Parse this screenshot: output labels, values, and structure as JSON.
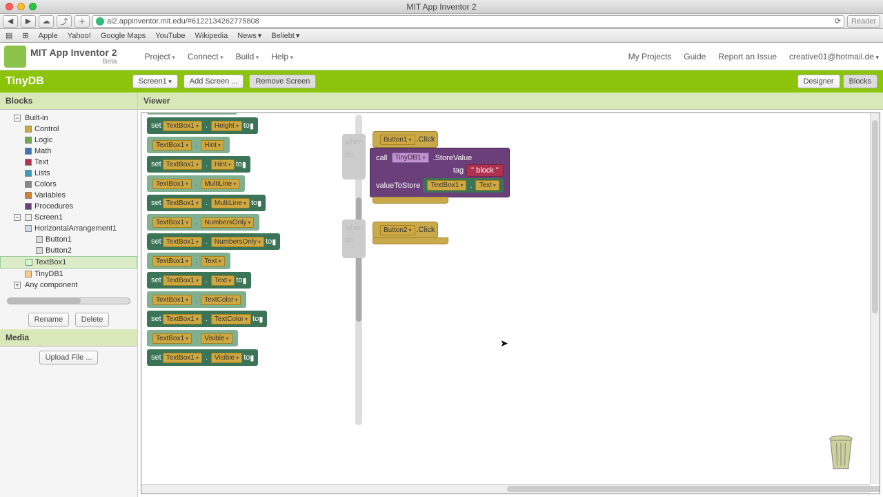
{
  "window": {
    "title": "MIT App Inventor 2"
  },
  "browser": {
    "url": "ai2.appinventor.mit.edu/#6122134262775808",
    "reader": "Reader",
    "bookmarks": [
      "Apple",
      "Yahoo!",
      "Google Maps",
      "YouTube",
      "Wikipedia",
      "News",
      "Beliebt"
    ]
  },
  "app": {
    "brand": "MIT App Inventor 2",
    "beta": "Beta",
    "menus": [
      "Project",
      "Connect",
      "Build",
      "Help"
    ],
    "links": {
      "myprojects": "My Projects",
      "guide": "Guide",
      "report": "Report an Issue",
      "account": "creative01@hotmail.de"
    }
  },
  "greenbar": {
    "project": "TinyDB",
    "screen": "Screen1",
    "addscreen": "Add Screen ...",
    "removescreen": "Remove Screen",
    "designer": "Designer",
    "blocks": "Blocks"
  },
  "sidebar": {
    "blocks_title": "Blocks",
    "builtin": "Built-in",
    "categories": [
      {
        "label": "Control",
        "color": "#d0a840"
      },
      {
        "label": "Logic",
        "color": "#6fa84f"
      },
      {
        "label": "Math",
        "color": "#3f71b5"
      },
      {
        "label": "Text",
        "color": "#b03050"
      },
      {
        "label": "Lists",
        "color": "#3f9ab5"
      },
      {
        "label": "Colors",
        "color": "#888"
      },
      {
        "label": "Variables",
        "color": "#d08030"
      },
      {
        "label": "Procedures",
        "color": "#6b3f7a"
      }
    ],
    "screen": "Screen1",
    "components": [
      "HorizontalArrangement1",
      "Button1",
      "Button2",
      "TextBox1",
      "TinyDB1"
    ],
    "anycomp": "Any component",
    "rename": "Rename",
    "delete": "Delete",
    "media": "Media",
    "upload": "Upload File ..."
  },
  "viewer": {
    "title": "Viewer",
    "palette_target": "TextBox1",
    "palette_props": [
      "Height",
      "Hint",
      "MultiLine",
      "NumbersOnly",
      "Text",
      "TextColor",
      "Visible"
    ],
    "set": "set",
    "to": "to",
    "workspace": {
      "evt1_target": "Button1",
      "evt1_event": ".Click",
      "call": "call",
      "tinydb": "TinyDB1",
      "method": ".StoreValue",
      "tag": "tag",
      "tagval": "block",
      "vts": "valueToStore",
      "vts_target": "TextBox1",
      "vts_prop": "Text",
      "evt2_target": "Button2",
      "evt2_event": ".Click",
      "when": "when",
      "do": "do"
    }
  }
}
